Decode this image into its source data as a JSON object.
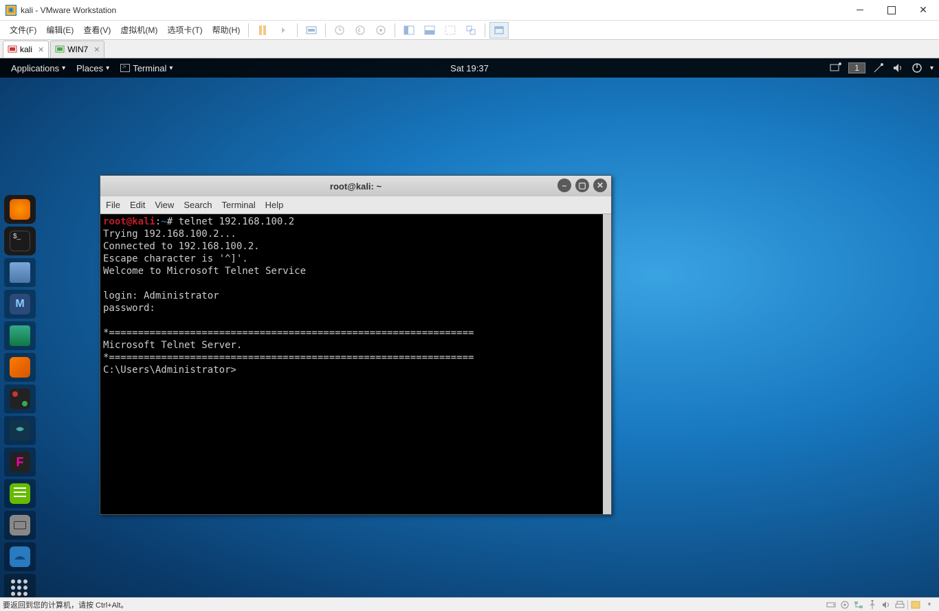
{
  "host": {
    "title": "kali - VMware Workstation",
    "window_buttons": {
      "min": "minimize",
      "max": "maximize",
      "close": "close"
    }
  },
  "vmware": {
    "menus": [
      "文件(F)",
      "编辑(E)",
      "查看(V)",
      "虚拟机(M)",
      "选项卡(T)",
      "帮助(H)"
    ],
    "tabs": [
      {
        "name": "kali",
        "active": true
      },
      {
        "name": "WIN7",
        "active": false
      }
    ],
    "status": "要返回到您的计算机，请按 Ctrl+Alt。"
  },
  "kali_panel": {
    "apps": "Applications",
    "places": "Places",
    "terminal": "Terminal",
    "clock": "Sat 19:37",
    "workspace": "1"
  },
  "terminal": {
    "title": "root@kali: ~",
    "menus": [
      "File",
      "Edit",
      "View",
      "Search",
      "Terminal",
      "Help"
    ],
    "prompt": {
      "user": "root@kali",
      "colon": ":",
      "path": "~",
      "hash": "# "
    },
    "command": "telnet 192.168.100.2",
    "output_lines": [
      "Trying 192.168.100.2...",
      "Connected to 192.168.100.2.",
      "Escape character is '^]'.",
      "Welcome to Microsoft Telnet Service",
      "",
      "login: Administrator",
      "password:",
      "",
      "*===============================================================",
      "Microsoft Telnet Server.",
      "*===============================================================",
      "C:\\Users\\Administrator>"
    ]
  }
}
